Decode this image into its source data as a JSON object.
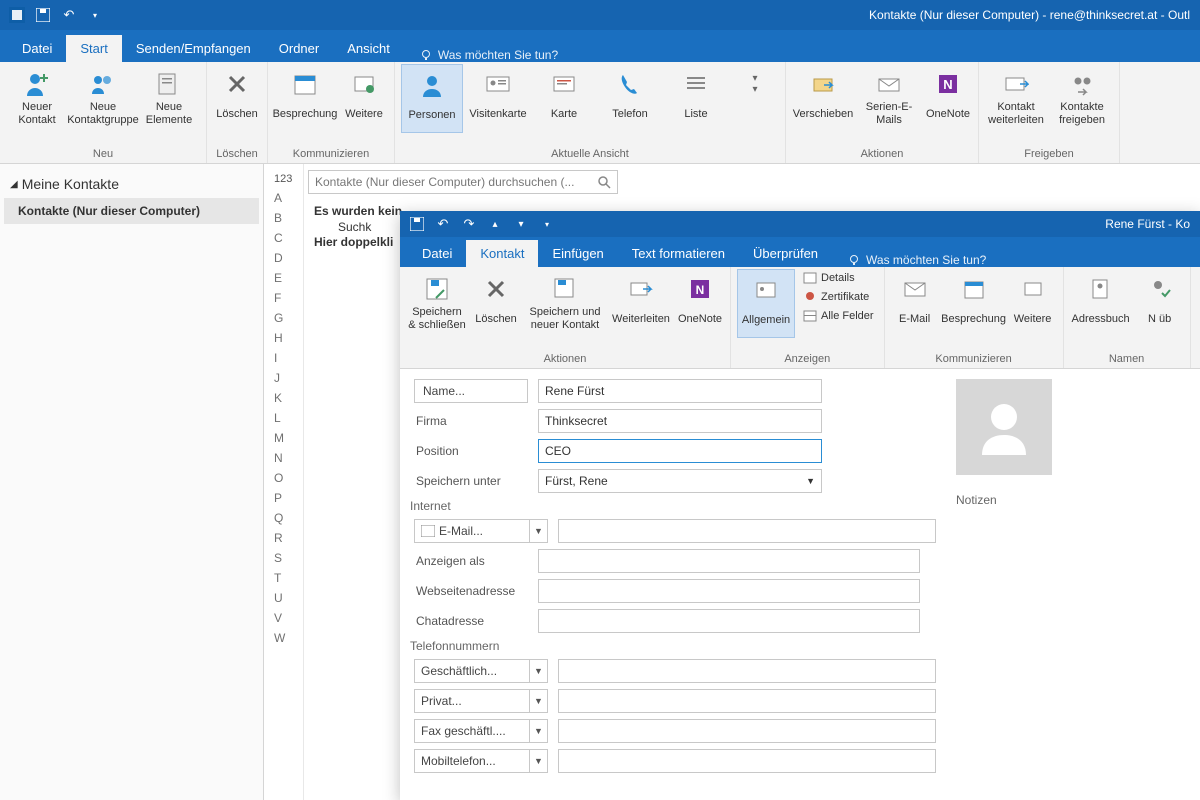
{
  "main_window": {
    "title": "Kontakte (Nur dieser Computer) - rene@thinksecret.at - Outl",
    "tabs": [
      "Datei",
      "Start",
      "Senden/Empfangen",
      "Ordner",
      "Ansicht"
    ],
    "active_tab": 1,
    "tell_me": "Was möchten Sie tun?",
    "ribbon": {
      "groups": [
        {
          "title": "Neu",
          "buttons": [
            {
              "label": "Neuer Kontakt"
            },
            {
              "label": "Neue Kontaktgruppe"
            },
            {
              "label": "Neue Elemente"
            }
          ]
        },
        {
          "title": "Löschen",
          "buttons": [
            {
              "label": "Löschen"
            }
          ]
        },
        {
          "title": "Kommunizieren",
          "buttons": [
            {
              "label": "Besprechung"
            },
            {
              "label": "Weitere"
            }
          ]
        },
        {
          "title": "Aktuelle Ansicht",
          "buttons": [
            {
              "label": "Personen",
              "selected": true
            },
            {
              "label": "Visitenkarte"
            },
            {
              "label": "Karte"
            },
            {
              "label": "Telefon"
            },
            {
              "label": "Liste"
            }
          ]
        },
        {
          "title": "Aktionen",
          "buttons": [
            {
              "label": "Verschieben"
            },
            {
              "label": "Serien-E-Mails"
            },
            {
              "label": "OneNote"
            }
          ]
        },
        {
          "title": "Freigeben",
          "buttons": [
            {
              "label": "Kontakt weiterleiten"
            },
            {
              "label": "Kontakte freigeben"
            }
          ]
        }
      ]
    },
    "nav": {
      "header": "Meine Kontakte",
      "items": [
        "Kontakte (Nur dieser Computer)"
      ]
    },
    "search_placeholder": "Kontakte (Nur dieser Computer) durchsuchen (...",
    "no_items_line1": "Es wurden kein",
    "no_items_line2": "Suchk",
    "no_items_line3": "Hier doppelkli",
    "alpha": [
      "123",
      "A",
      "B",
      "C",
      "D",
      "E",
      "F",
      "G",
      "H",
      "I",
      "J",
      "K",
      "L",
      "M",
      "N",
      "O",
      "P",
      "Q",
      "R",
      "S",
      "T",
      "U",
      "V",
      "W"
    ]
  },
  "contact_window": {
    "title": "Rene Fürst - Ko",
    "tabs": [
      "Datei",
      "Kontakt",
      "Einfügen",
      "Text formatieren",
      "Überprüfen"
    ],
    "active_tab": 1,
    "tell_me": "Was möchten Sie tun?",
    "ribbon": {
      "actions": {
        "title": "Aktionen",
        "buttons": [
          "Speichern & schließen",
          "Löschen",
          "Speichern und neuer Kontakt",
          "Weiterleiten",
          "OneNote"
        ]
      },
      "show": {
        "title": "Anzeigen",
        "allgemein": "Allgemein",
        "details": "Details",
        "zertifikate": "Zertifikate",
        "alle_felder": "Alle Felder"
      },
      "comm": {
        "title": "Kommunizieren",
        "buttons": [
          "E-Mail",
          "Besprechung",
          "Weitere"
        ]
      },
      "names": {
        "title": "Namen",
        "buttons": [
          "Adressbuch",
          "N üb"
        ]
      }
    },
    "form": {
      "name_btn": "Name...",
      "name_val": "Rene Fürst",
      "firma_lbl": "Firma",
      "firma_val": "Thinksecret",
      "position_lbl": "Position",
      "position_val": "CEO",
      "file_as_lbl": "Speichern unter",
      "file_as_val": "Fürst, Rene",
      "internet_lbl": "Internet",
      "email_btn": "E-Mail...",
      "email_val": "",
      "anzeigen_lbl": "Anzeigen als",
      "anzeigen_val": "",
      "web_lbl": "Webseitenadresse",
      "web_val": "",
      "chat_lbl": "Chatadresse",
      "chat_val": "",
      "phone_lbl": "Telefonnummern",
      "p1": "Geschäftlich...",
      "p2": "Privat...",
      "p3": "Fax geschäftl....",
      "p4": "Mobiltelefon...",
      "notes_lbl": "Notizen"
    }
  }
}
